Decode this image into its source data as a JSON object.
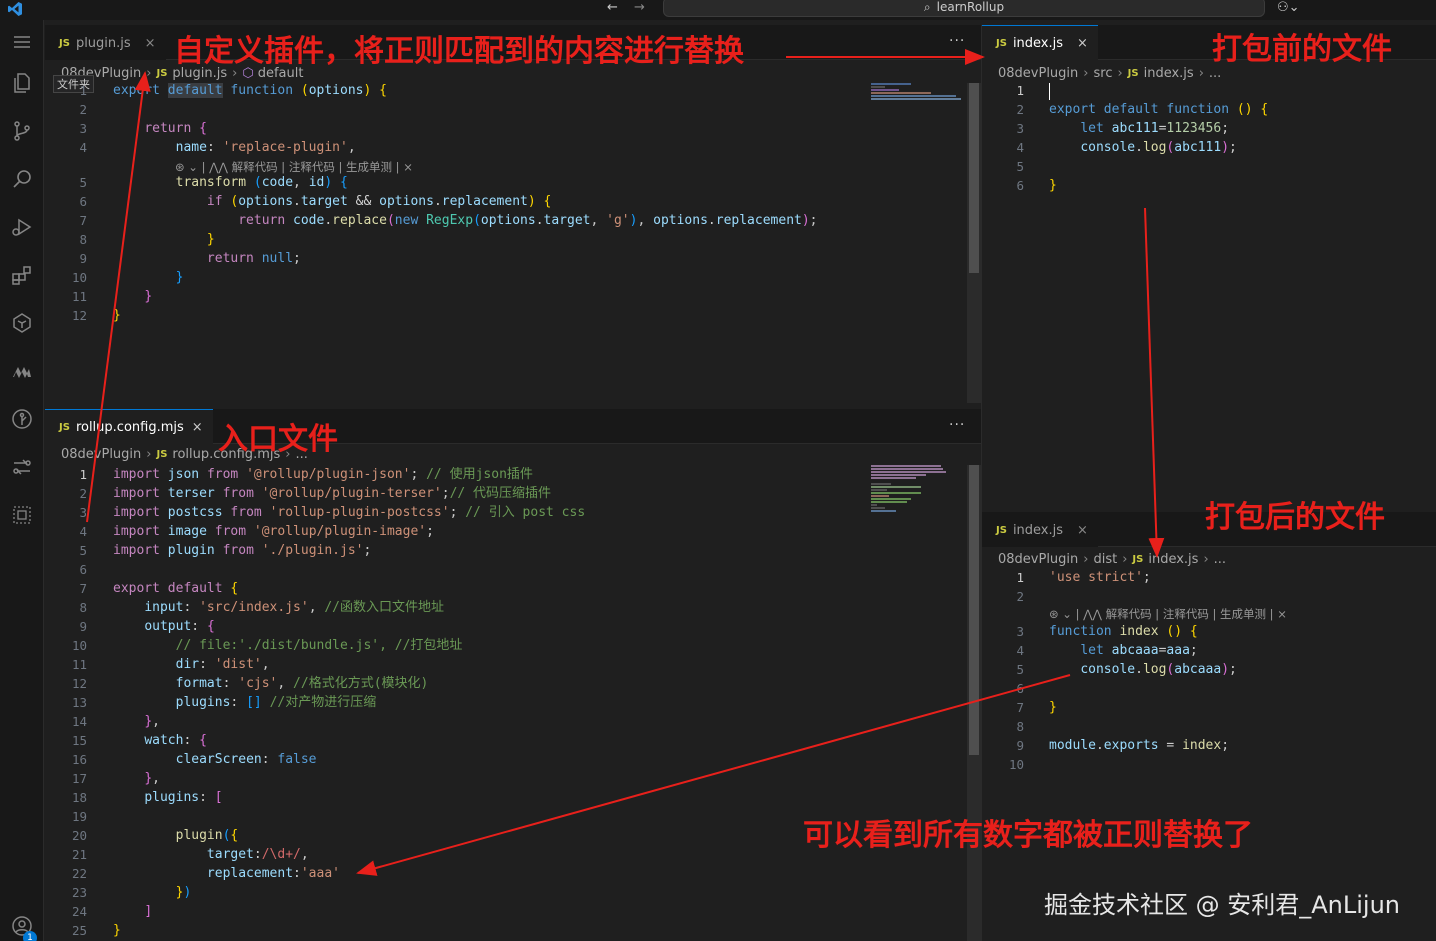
{
  "titlebar": {
    "search_text": "learnRollup",
    "back_glyph": "←",
    "forward_glyph": "→",
    "copilot_glyph": "⚇⌄"
  },
  "activity_bar": {
    "items": [
      "files-icon",
      "source-control-icon",
      "search-icon",
      "run-debug-icon",
      "extensions-icon",
      "ai-assistant-icon",
      "marscode-icon",
      "gitlens-icon",
      "remote-icon",
      "docker-icon",
      "account-icon"
    ],
    "badge": "1"
  },
  "top_left_editor": {
    "tab": {
      "badge": "JS",
      "label": "plugin.js",
      "close": "×"
    },
    "more": "···",
    "breadcrumb": {
      "folder": "08devPlugin",
      "file_badge": "JS",
      "file": "plugin.js",
      "symbol": "default"
    },
    "tooltip": "文件夹",
    "codelens": "⊛ ⌄ | ⋀⋀ 解释代码 | 注释代码 | 生成单测 | ×",
    "line_numbers": [
      "1",
      "2",
      "3",
      "4",
      "5",
      "6",
      "7",
      "8",
      "9",
      "10",
      "11",
      "12"
    ]
  },
  "bottom_left_editor": {
    "tab": {
      "badge": "JS",
      "label": "rollup.config.mjs",
      "close": "×"
    },
    "more": "···",
    "breadcrumb": {
      "folder": "08devPlugin",
      "file_badge": "JS",
      "file": "rollup.config.mjs",
      "trail": "..."
    },
    "line_numbers": [
      "1",
      "2",
      "3",
      "4",
      "5",
      "6",
      "7",
      "8",
      "9",
      "10",
      "11",
      "12",
      "13",
      "14",
      "15",
      "16",
      "17",
      "18",
      "19",
      "20",
      "21",
      "22",
      "23",
      "24",
      "25"
    ]
  },
  "top_right_editor": {
    "tab": {
      "badge": "JS",
      "label": "index.js",
      "close": "×"
    },
    "breadcrumb": {
      "folder": "08devPlugin",
      "sub": "src",
      "file_badge": "JS",
      "file": "index.js",
      "trail": "..."
    },
    "line_numbers": [
      "1",
      "2",
      "3",
      "4",
      "5",
      "6"
    ]
  },
  "bottom_right_editor": {
    "tab": {
      "badge": "JS",
      "label": "index.js",
      "close": "×"
    },
    "breadcrumb": {
      "folder": "08devPlugin",
      "sub": "dist",
      "file_badge": "JS",
      "file": "index.js",
      "trail": "..."
    },
    "codelens": "⊛ ⌄ | ⋀⋀ 解释代码 | 注释代码 | 生成单测 | ×",
    "line_numbers": [
      "1",
      "2",
      "3",
      "4",
      "5",
      "6",
      "7",
      "8",
      "9",
      "10"
    ]
  },
  "annotations": {
    "plugin_note": "自定义插件，将正则匹配到的内容进行替换",
    "before_note": "打包前的文件",
    "entry_note": "入口文件",
    "after_note": "打包后的文件",
    "result_note": "可以看到所有数字都被正则替换了",
    "watermark": "掘金技术社区 @ 安利君_AnLijun"
  },
  "colors": {
    "annotation_red": "#e8201b",
    "editor_bg": "#1f1f1f",
    "keyword_blue": "#569cd6",
    "string_orange": "#ce9178",
    "comment_green": "#6a9955"
  }
}
